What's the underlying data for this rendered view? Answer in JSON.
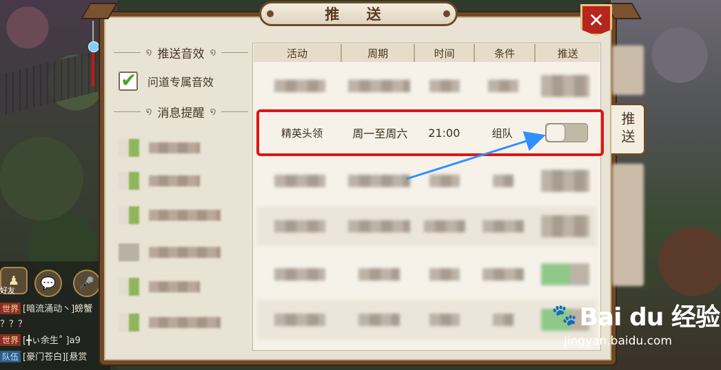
{
  "window": {
    "title": "推 送",
    "close_glyph": "✕"
  },
  "side_tab": {
    "label": "推送"
  },
  "settings": {
    "sound_section": "推送音效",
    "sound_option": {
      "label": "问道专属音效",
      "checked": true
    },
    "reminder_section": "消息提醒"
  },
  "table": {
    "headers": [
      "活动",
      "周期",
      "时间",
      "条件",
      "推送"
    ],
    "highlighted_row": {
      "activity": "精英头领",
      "cycle": "周一至周六",
      "time": "21:00",
      "condition": "组队",
      "push_enabled": false
    }
  },
  "chat": {
    "friends_label": "好友",
    "lines": [
      {
        "tag": "世界",
        "text": "[暗流涌动丶]螃蟹"
      },
      {
        "tag": "",
        "text": "？？？"
      },
      {
        "tag": "世界",
        "text": "[╋ぃ余生˚ ]a9"
      },
      {
        "tag": "队伍",
        "text": "[豪门苍白][悬赏"
      }
    ]
  },
  "watermark": {
    "brand": "Bai du 经验",
    "url": "jingyan.baidu.com"
  },
  "colors": {
    "highlight": "#e01414",
    "arrow": "#2f8fff",
    "accent_green": "#4aa32a",
    "close_red": "#b6261d"
  }
}
